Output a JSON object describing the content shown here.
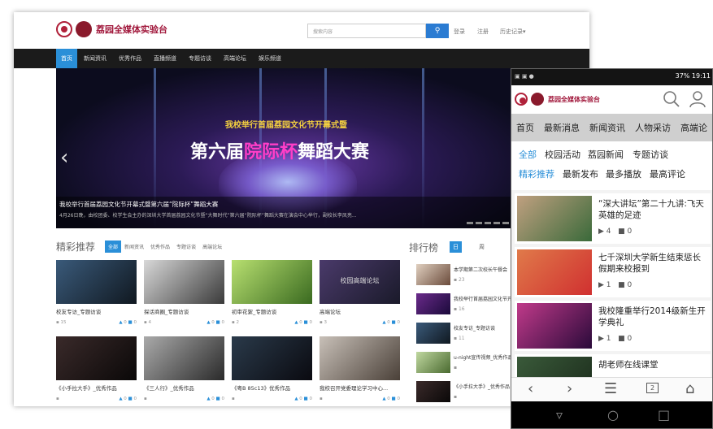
{
  "desktop": {
    "logo_text": "荔园全媒体实验台",
    "search_placeholder": "搜索内容",
    "login": "登录",
    "register": "注册",
    "history": "历史记录▾",
    "nav": [
      "首页",
      "新闻资讯",
      "优秀作品",
      "直播频道",
      "专题访谈",
      "高端论坛",
      "娱乐频道"
    ],
    "banner": {
      "subtitle": "我校举行首届荔园文化节开幕式暨",
      "title_a": "第六届",
      "title_hl": "院际杯",
      "title_b": "舞蹈大赛",
      "caption": "我校举行首届荔园文化节开幕式暨第六届“院际杯”舞蹈大赛",
      "caption_desc": "4月26日晚，由校团委、校学生会主办的深圳大学首届荔园文化节暨“大舞时代”第六届“院际杯”舞蹈大赛在演会中心举行，副校长李凤亮..."
    },
    "recommend": {
      "title": "精彩推荐",
      "tabs": [
        "全部",
        "新闻资讯",
        "优秀作品",
        "专题访谈",
        "高端论坛"
      ],
      "cards": [
        {
          "title": "校友专访_专题访谈",
          "views": "15",
          "likes": "0",
          "comments": "0",
          "c1": "#3a5a7a",
          "c2": "#101820"
        },
        {
          "title": "探话商圈_专题访谈",
          "views": "4",
          "likes": "0",
          "comments": "0",
          "c1": "#d8d8d8",
          "c2": "#3a3a3a"
        },
        {
          "title": "初审花絮_专题访谈",
          "views": "2",
          "likes": "0",
          "comments": "0",
          "c1": "#b8e070",
          "c2": "#3a6a20"
        },
        {
          "title": "高端论坛",
          "views": "3",
          "likes": "0",
          "comments": "0",
          "c1": "#4a3a6a",
          "c2": "#1a1a2a",
          "overlay": "校园高端论坛"
        },
        {
          "title": "《小手拉大手》_优秀作品",
          "views": "",
          "likes": "0",
          "comments": "0",
          "c1": "#3a2a2a",
          "c2": "#0a0808"
        },
        {
          "title": "《三人行》_优秀作品",
          "views": "",
          "likes": "0",
          "comments": "0",
          "c1": "#aaaaaa",
          "c2": "#2a2a2a"
        },
        {
          "title": "《粤B 85c13》优秀作品",
          "views": "",
          "likes": "0",
          "comments": "0",
          "c1": "#2a3a4a",
          "c2": "#0a0a10"
        },
        {
          "title": "我校召开党委理论学习中心...",
          "views": "",
          "likes": "0",
          "comments": "0",
          "c1": "#c8c0b8",
          "c2": "#4a4038"
        }
      ]
    },
    "ranking": {
      "title": "排行榜",
      "tab_day": "日",
      "tab_week": "周",
      "items": [
        {
          "title": "本学期第二次校长午餐会",
          "count": "23",
          "c1": "#e0d0c0",
          "c2": "#6a4a3a"
        },
        {
          "title": "我校举行首届荔园文化节开幕式",
          "count": "16",
          "c1": "#6a2a8a",
          "c2": "#1a0a3a"
        },
        {
          "title": "校友专访_专题访谈",
          "count": "11",
          "c1": "#3a5a7a",
          "c2": "#101820"
        },
        {
          "title": "u-night宣传视频_优秀作品",
          "count": "",
          "c1": "#c0d8a0",
          "c2": "#4a6a30"
        },
        {
          "title": "《小手拉大手》_优秀作品",
          "count": "",
          "c1": "#3a2a2a",
          "c2": "#0a0808"
        }
      ]
    }
  },
  "phone": {
    "status_right": "37% 19:11",
    "logo_text": "荔园全媒体实验台",
    "nav": [
      "首页",
      "最新消息",
      "新闻资讯",
      "人物采访",
      "高端论"
    ],
    "cats_row1": [
      "全部",
      "校园活动",
      "荔园新闻",
      "专题访谈"
    ],
    "cats_row2": [
      "精彩推荐",
      "最新发布",
      "最多播放",
      "最高评论"
    ],
    "items": [
      {
        "title": "“深大讲坛”第二十九讲:飞天英雄的足迹",
        "views": "4",
        "comments": "0",
        "c1": "#c0a080",
        "c2": "#3a6a3a"
      },
      {
        "title": "七千深圳大学新生结束惩长假期来校报到",
        "views": "1",
        "comments": "0",
        "c1": "#e07a4a",
        "c2": "#d03030"
      },
      {
        "title": "我校隆重举行2014级新生开学典礼",
        "views": "1",
        "comments": "0",
        "c1": "#c03a8a",
        "c2": "#2a0a3a"
      },
      {
        "title": "胡老师在线课堂",
        "views": "",
        "comments": "",
        "c1": "#3a5a3a",
        "c2": "#1a2a1a"
      }
    ],
    "tab_count": "2"
  }
}
